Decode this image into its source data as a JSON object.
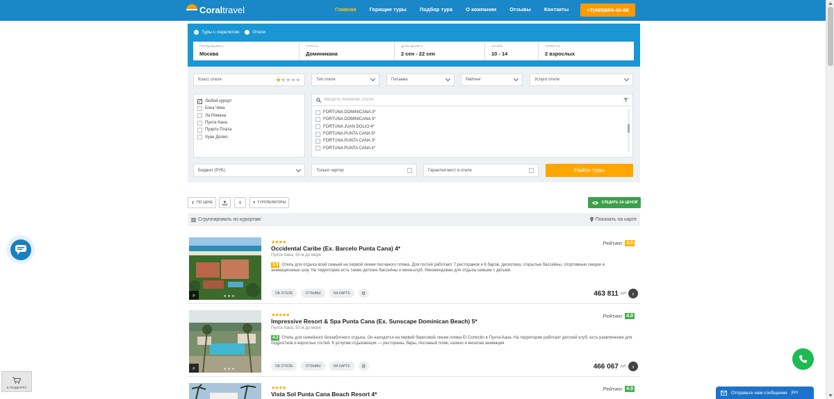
{
  "header": {
    "logo": {
      "part1": "Coral",
      "part2": "travel"
    },
    "nav": [
      {
        "label": "Главная",
        "active": true
      },
      {
        "label": "Горящие туры",
        "active": false
      },
      {
        "label": "Подбор тура",
        "active": false
      },
      {
        "label": "О компании",
        "active": false
      },
      {
        "label": "Отзывы",
        "active": false
      },
      {
        "label": "Контакты",
        "active": false
      }
    ],
    "phone": "+7(495)664-40-66"
  },
  "search": {
    "radio_flight": "Туры с перелетом",
    "radio_hotels": "Отели",
    "fields": [
      {
        "label": "Город вылета",
        "value": "Москва"
      },
      {
        "label": "Страна",
        "value": "Доминикана"
      },
      {
        "label": "Даты вылета",
        "value": "2 сен - 22 сен"
      },
      {
        "label": "Ночей",
        "value": "10 - 14"
      },
      {
        "label": "Туристы",
        "value": "2 взрослых"
      }
    ]
  },
  "filters": {
    "hotel_class": "Класс отеля",
    "hotel_type": "Тип отеля",
    "meals": "Питание",
    "rating": "Рейтинг",
    "services": "Услуги отеля",
    "resorts": [
      "Любой курорт",
      "Бока Чика",
      "Ла Романа",
      "Пунта Кана",
      "Пуэрто Плата",
      "Хуан Долио"
    ],
    "hotel_search_placeholder": "ВВЕДИТЕ НАЗВАНИЕ ОТЕЛЯ",
    "hotels": [
      "FORTUNA DOMINICANA 3*",
      "FORTUNA DOMINICANA 5*",
      "FORTUNA JUAN DOLIO 4*",
      "FORTUNA PUNTA CANA 5*",
      "FORTUNA PUNTA CANA 3*",
      "FORTUNA PUNTA CANA 4*"
    ],
    "budget": "Бюджет (РУБ)",
    "charter_only": "Только чартер",
    "guarantee": "Гарантия мест в отеле",
    "find_button": "Найти туры"
  },
  "toolbar": {
    "sort_price": "ПО ЦЕНЕ",
    "operators": "ТУРОПЕРАТОРЫ",
    "follow_price": "СЛЕДИТЬ ЗА ЦЕНОЙ",
    "group_by": "Сгруппировать по курортам",
    "show_map": "Показать на карте"
  },
  "hotels": [
    {
      "stars": "★★★★",
      "name": "Occidental Caribe (Ex. Barcelo Punta Cana) 4*",
      "location": "Пунта Кана, 50 м до моря",
      "score": "3.9",
      "score_color": "#ffb300",
      "description": "Отель для отдыха всей семьей на первой линии песчаного пляжа. Для гостей работают 7 ресторанов и 8 баров, дискотека, открытые бассейны, спортивные секции и анимационные шоу. На территории есть также детские бассейны и мини-клуб. Рекомендован для отдыха семьям с детьми.",
      "rating_label": "Рейтинг:",
      "rating": "3.5",
      "rating_color": "#ffb300",
      "price": "463 811",
      "currency": "руб"
    },
    {
      "stars": "★★★★★",
      "name": "Impressive Resort & Spa Punta Cana (Ex. Sunscape Dominican Beach) 5*",
      "location": "Пунта Кана, 50 м до моря",
      "score": "4.2",
      "score_color": "#4caf50",
      "description": "Отель для семейного беззаботного отдыха. Он находится на первой береговой линии пляжа El Cortecito в Пунта-Кана. На территории работает детский клуб, есть развлечения для подростков и взрослых гостей. К услугам отдыхающих — рестораны, бары, песчаный пляж, казино и веселая анимация.",
      "rating_label": "Рейтинг:",
      "rating": "4.0",
      "rating_color": "#4caf50",
      "price": "466 067",
      "currency": "руб"
    },
    {
      "stars": "★★★★",
      "name": "Vista Sol Punta Cana Beach Resort 4*",
      "location": "",
      "score": "",
      "score_color": "#4caf50",
      "description": "",
      "rating_label": "Рейтинг:",
      "rating": "4.0",
      "rating_color": "#4caf50",
      "price": "",
      "currency": ""
    }
  ],
  "card_buttons": {
    "about": "ОБ ОТЕЛЕ",
    "reviews": "ОТЗЫВЫ",
    "map": "НА КАРТЕ"
  },
  "widgets": {
    "podbor": "В ПОДБОРКУ",
    "message": "Отправьте нам сообщение",
    "message_tail": "jivo"
  }
}
